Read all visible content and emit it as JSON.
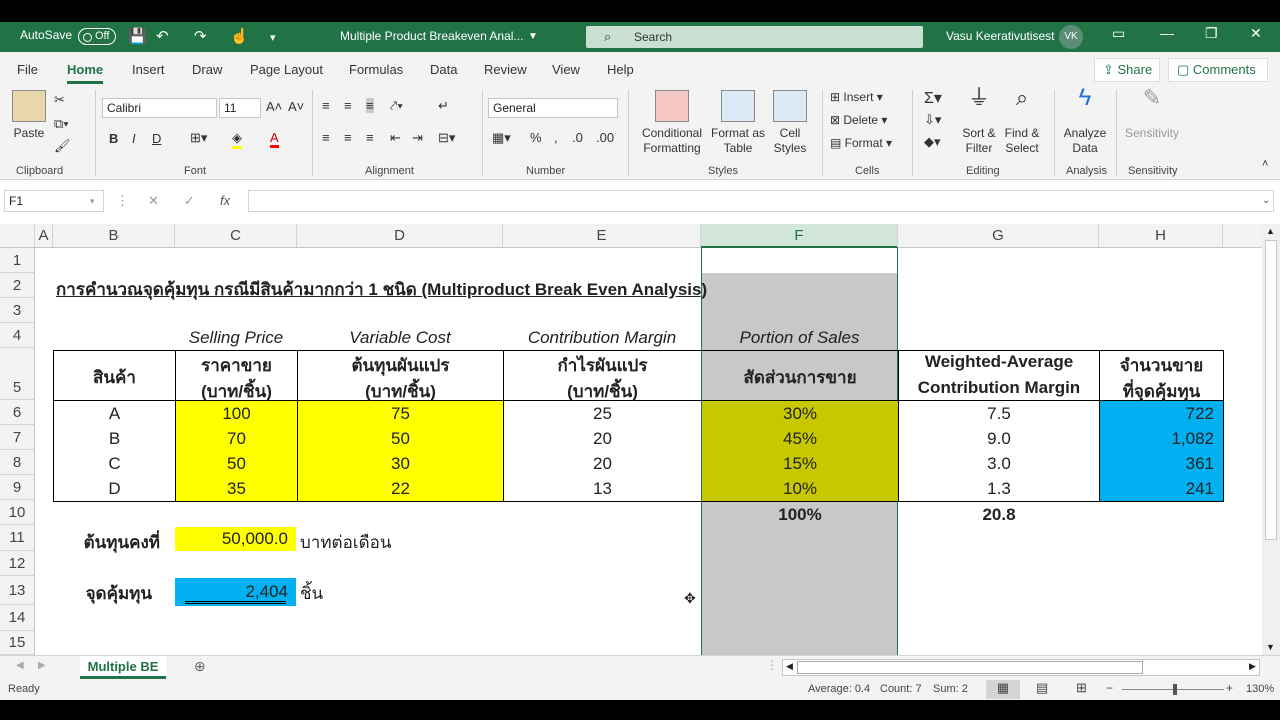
{
  "title_bar": {
    "autosave": "AutoSave",
    "toggle": "Off",
    "doc_title": "Multiple Product Breakeven Anal...",
    "search": "Search",
    "user": "Vasu Keerativutisest",
    "initials": "VK"
  },
  "menu": {
    "items": [
      "File",
      "Home",
      "Insert",
      "Draw",
      "Page Layout",
      "Formulas",
      "Data",
      "Review",
      "View",
      "Help"
    ],
    "share": "Share",
    "comments": "Comments"
  },
  "ribbon": {
    "clipboard": {
      "paste": "Paste",
      "label": "Clipboard"
    },
    "font": {
      "name": "Calibri",
      "size": "11",
      "bold": "B",
      "italic": "I",
      "underline": "D",
      "label": "Font"
    },
    "alignment": {
      "label": "Alignment"
    },
    "number": {
      "format": "General",
      "label": "Number"
    },
    "styles": {
      "cond_1": "Conditional",
      "cond_2": "Formatting",
      "fmt_1": "Format as",
      "fmt_2": "Table",
      "cell_1": "Cell",
      "cell_2": "Styles",
      "label": "Styles"
    },
    "cells": {
      "insert": "Insert",
      "delete": "Delete",
      "format": "Format",
      "label": "Cells"
    },
    "editing": {
      "sort_1": "Sort &",
      "sort_2": "Filter",
      "find_1": "Find &",
      "find_2": "Select",
      "label": "Editing"
    },
    "analysis": {
      "a1": "Analyze",
      "a2": "Data",
      "label": "Analysis"
    },
    "sensitivity": {
      "s1": "Sensitivity",
      "label": "Sensitivity"
    }
  },
  "formula_bar": {
    "name_box": "F1",
    "fx": "fx",
    "value": ""
  },
  "columns": [
    "A",
    "B",
    "C",
    "D",
    "E",
    "F",
    "G",
    "H"
  ],
  "rows": [
    "1",
    "2",
    "3",
    "4",
    "5",
    "6",
    "7",
    "8",
    "9",
    "10",
    "11",
    "12",
    "13",
    "14",
    "15"
  ],
  "sheet": {
    "title": "การคำนวณจุดคุ้มทุน กรณีมีสินค้ามากกว่า 1 ชนิด (Multiproduct Break Even Analysis)",
    "sub_headers": {
      "c": "Selling Price",
      "d": "Variable Cost",
      "e": "Contribution Margin",
      "f": "Portion of Sales"
    },
    "headers": {
      "b": "สินค้า",
      "c1": "ราคาขาย",
      "c2": "(บาท/ชิ้น)",
      "d1": "ต้นทุนผันแปร",
      "d2": "(บาท/ชิ้น)",
      "e1": "กำไรผันแปร",
      "e2": "(บาท/ชิ้น)",
      "f": "สัดส่วนการขาย",
      "g1": "Weighted-Average",
      "g2": "Contribution Margin",
      "h1": "จำนวนขาย",
      "h2": "ที่จุดคุ้มทุน"
    },
    "products": [
      {
        "name": "A",
        "price": "100",
        "vc": "75",
        "cm": "25",
        "portion": "30%",
        "wacm": "7.5",
        "units": "722"
      },
      {
        "name": "B",
        "price": "70",
        "vc": "50",
        "cm": "20",
        "portion": "45%",
        "wacm": "9.0",
        "units": "1,082"
      },
      {
        "name": "C",
        "price": "50",
        "vc": "30",
        "cm": "20",
        "portion": "15%",
        "wacm": "3.0",
        "units": "361"
      },
      {
        "name": "D",
        "price": "35",
        "vc": "22",
        "cm": "13",
        "portion": "10%",
        "wacm": "1.3",
        "units": "241"
      }
    ],
    "totals": {
      "portion": "100%",
      "wacm": "20.8"
    },
    "fixed_cost": {
      "label": "ต้นทุนคงที่",
      "value": "50,000.0",
      "unit": "บาทต่อเดือน"
    },
    "breakeven": {
      "label": "จุดคุ้มทุน",
      "value": "2,404",
      "unit": "ชิ้น"
    }
  },
  "sheet_tab": {
    "name": "Multiple BE"
  },
  "status": {
    "ready": "Ready",
    "average": "Average: 0.4",
    "count": "Count: 7",
    "sum": "Sum: 2",
    "zoom": "130%"
  }
}
